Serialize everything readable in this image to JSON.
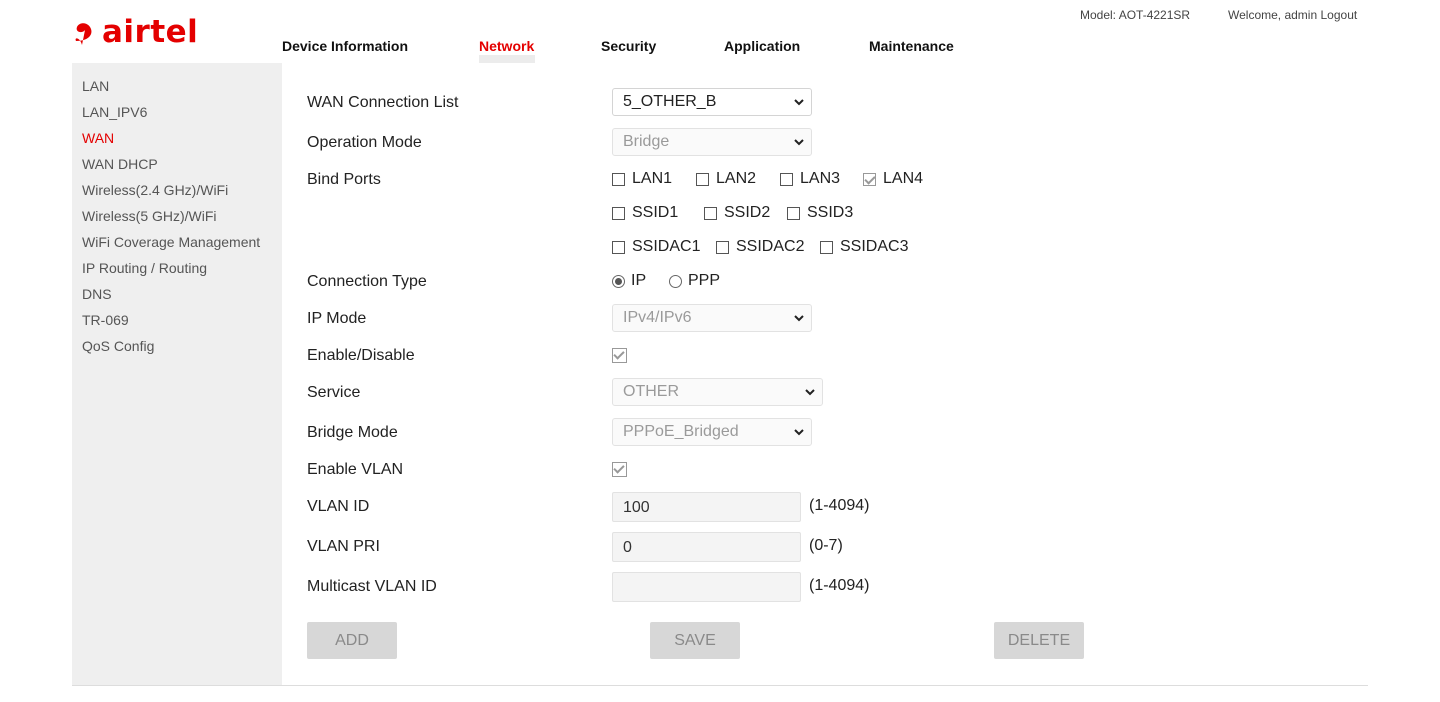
{
  "header": {
    "brand": "airtel",
    "model": "Model: AOT-4221SR",
    "welcome": "Welcome, admin",
    "logout": "Logout",
    "brand_color": "#e40000"
  },
  "nav": [
    {
      "label": "Device Information",
      "active": false
    },
    {
      "label": "Network",
      "active": true
    },
    {
      "label": "Security",
      "active": false
    },
    {
      "label": "Application",
      "active": false
    },
    {
      "label": "Maintenance",
      "active": false
    }
  ],
  "sidebar": [
    {
      "label": "LAN"
    },
    {
      "label": "LAN_IPV6"
    },
    {
      "label": "WAN",
      "active": true
    },
    {
      "label": "WAN DHCP"
    },
    {
      "label": "Wireless(2.4 GHz)/WiFi"
    },
    {
      "label": "Wireless(5 GHz)/WiFi"
    },
    {
      "label": "WiFi Coverage Management"
    },
    {
      "label": "IP Routing / Routing"
    },
    {
      "label": "DNS"
    },
    {
      "label": "TR-069"
    },
    {
      "label": "QoS Config"
    }
  ],
  "form": {
    "wan_connection_list": {
      "label": "WAN Connection List",
      "value": "5_OTHER_B"
    },
    "operation_mode": {
      "label": "Operation Mode",
      "value": "Bridge"
    },
    "bind_ports": {
      "label": "Bind Ports",
      "row1": [
        {
          "label": "LAN1",
          "checked": false
        },
        {
          "label": "LAN2",
          "checked": false
        },
        {
          "label": "LAN3",
          "checked": false
        },
        {
          "label": "LAN4",
          "checked": true
        }
      ],
      "row2": [
        {
          "label": "SSID1",
          "checked": false
        },
        {
          "label": "SSID2",
          "checked": false
        },
        {
          "label": "SSID3",
          "checked": false
        }
      ],
      "row3": [
        {
          "label": "SSIDAC1",
          "checked": false
        },
        {
          "label": "SSIDAC2",
          "checked": false
        },
        {
          "label": "SSIDAC3",
          "checked": false
        }
      ]
    },
    "connection_type": {
      "label": "Connection Type",
      "options": [
        {
          "label": "IP",
          "selected": true
        },
        {
          "label": "PPP",
          "selected": false
        }
      ]
    },
    "ip_mode": {
      "label": "IP Mode",
      "value": "IPv4/IPv6"
    },
    "enable_disable": {
      "label": "Enable/Disable",
      "checked": true
    },
    "service": {
      "label": "Service",
      "value": "OTHER"
    },
    "bridge_mode": {
      "label": "Bridge Mode",
      "value": "PPPoE_Bridged"
    },
    "enable_vlan": {
      "label": "Enable VLAN",
      "checked": true
    },
    "vlan_id": {
      "label": "VLAN ID",
      "value": "100",
      "range": "(1-4094)"
    },
    "vlan_pri": {
      "label": "VLAN PRI",
      "value": "0",
      "range": "(0-7)"
    },
    "multicast_vlan_id": {
      "label": "Multicast VLAN ID",
      "value": "",
      "range": "(1-4094)"
    }
  },
  "buttons": {
    "add": "ADD",
    "save": "SAVE",
    "delete": "DELETE"
  }
}
